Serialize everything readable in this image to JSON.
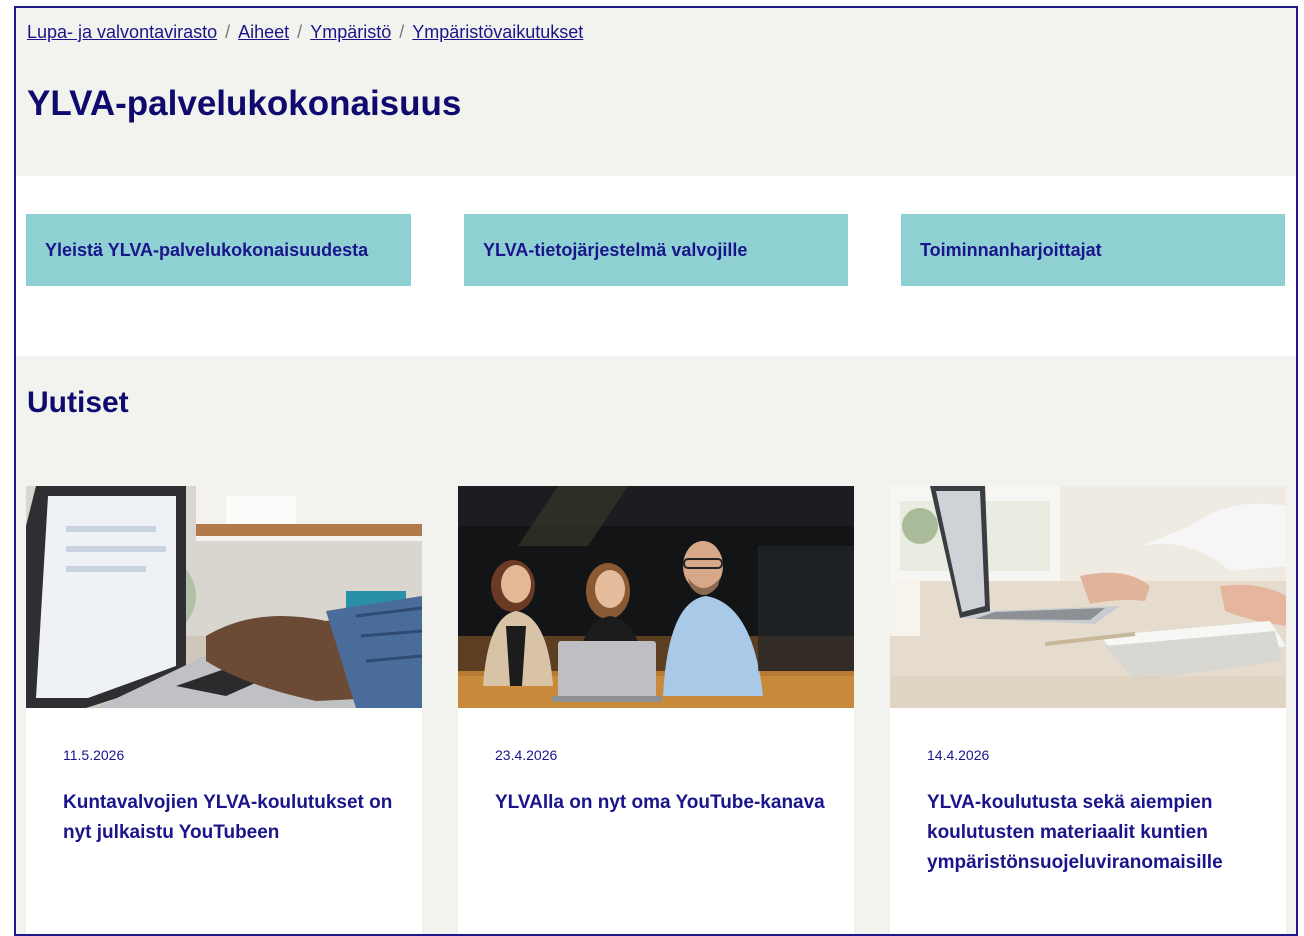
{
  "breadcrumb": [
    {
      "label": "Lupa- ja valvontavirasto"
    },
    {
      "label": "Aiheet"
    },
    {
      "label": "Ympäristö"
    },
    {
      "label": "Ympäristövaikutukset"
    }
  ],
  "breadcrumb_separator": "/",
  "page_title": "YLVA-palvelukokonaisuus",
  "tiles": [
    {
      "label": "Yleistä YLVA-palvelukokonaisuudesta"
    },
    {
      "label": "YLVA-tietojärjestelmä valvojille"
    },
    {
      "label": "Toiminnanharjoittajat"
    }
  ],
  "news": {
    "heading": "Uutiset",
    "items": [
      {
        "date": "11.5.2026",
        "title": "Kuntavalvojien YLVA-koulutukset on nyt julkaistu YouTubeen",
        "image": "laptop-typing-photo"
      },
      {
        "date": "23.4.2026",
        "title": "YLVAlla on nyt oma YouTube-kanava",
        "image": "three-people-laptop-photo"
      },
      {
        "date": "14.4.2026",
        "title": "YLVA-koulutusta sekä aiempien koulutusten materiaalit kuntien ympäristönsuojeluviranomaisille",
        "image": "desk-laptop-photo"
      }
    ]
  },
  "colors": {
    "brand_navy": "#1a158a",
    "tile_teal": "#8fd0d3",
    "section_bg": "#f2f2ee"
  }
}
